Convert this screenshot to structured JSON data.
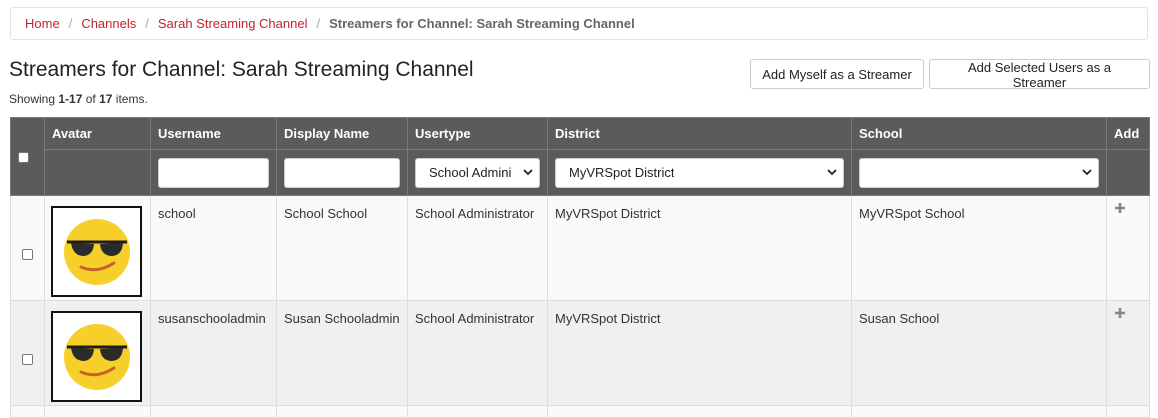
{
  "breadcrumb": {
    "items": [
      "Home",
      "Channels",
      "Sarah Streaming Channel"
    ],
    "separator": "/",
    "active": "Streamers for Channel: Sarah Streaming Channel"
  },
  "page": {
    "title": "Streamers for Channel: Sarah Streaming Channel",
    "summary_prefix": "Showing ",
    "summary_range": "1-17",
    "summary_mid": " of ",
    "summary_total": "17",
    "summary_suffix": " items."
  },
  "toolbar": {
    "add_myself_label": "Add Myself as a Streamer",
    "add_selected_label": "Add Selected Users as a Streamer"
  },
  "table": {
    "columns": {
      "avatar": "Avatar",
      "username": "Username",
      "display_name": "Display Name",
      "usertype": "Usertype",
      "district": "District",
      "school": "School",
      "add": "Add"
    },
    "filters": {
      "username": "",
      "display_name": "",
      "usertype": "School Admini",
      "district": "MyVRSpot District",
      "school": ""
    },
    "rows": [
      {
        "username": "school",
        "display_name": "School School",
        "usertype": "School Administrator",
        "district": "MyVRSpot District",
        "school": "MyVRSpot School",
        "avatar_icon": "sunglasses-emoji-icon"
      },
      {
        "username": "susanschooladmin",
        "display_name": "Susan Schooladmin",
        "usertype": "School Administrator",
        "district": "MyVRSpot District",
        "school": "Susan School",
        "avatar_icon": "sunglasses-emoji-icon"
      }
    ]
  },
  "colors": {
    "accent": "#c0242c",
    "header_bg": "#5b5b5b",
    "emoji_yellow": "#f7cf2b"
  }
}
